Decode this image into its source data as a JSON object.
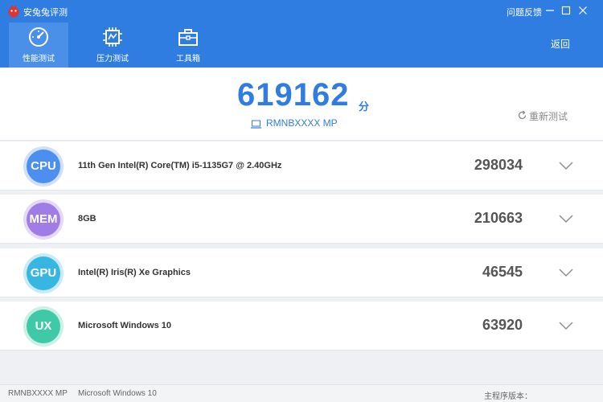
{
  "app": {
    "title": "安兔兔评测",
    "feedback": "问题反馈",
    "window_controls": [
      "minimize-icon",
      "maximize-icon",
      "close-icon"
    ]
  },
  "nav": {
    "tabs": [
      {
        "label": "性能测试",
        "icon": "speedometer-icon",
        "active": true
      },
      {
        "label": "压力测试",
        "icon": "chip-icon",
        "active": false
      },
      {
        "label": "工具箱",
        "icon": "toolbox-icon",
        "active": false
      }
    ],
    "back": "返回"
  },
  "score": {
    "total": "619162",
    "unit": "分",
    "device": "RMNBXXXX MP",
    "retest": "重新测试"
  },
  "rows": [
    {
      "badge": "CPU",
      "desc": "11th Gen Intel(R) Core(TM) i5-1135G7 @ 2.40GHz",
      "score": "298034",
      "color": "#4d8ff0",
      "ring": "#cfe0fb"
    },
    {
      "badge": "MEM",
      "desc": "8GB",
      "score": "210663",
      "color": "#a07de6",
      "ring": "#e4d9f7"
    },
    {
      "badge": "GPU",
      "desc": "Intel(R) Iris(R) Xe Graphics",
      "score": "46545",
      "color": "#36b6e0",
      "ring": "#c9ebf7"
    },
    {
      "badge": "UX",
      "desc": "Microsoft Windows 10",
      "score": "63920",
      "color": "#3fc9a6",
      "ring": "#cbf0e5"
    }
  ],
  "status": {
    "device": "RMNBXXXX MP",
    "os": "Microsoft Windows 10",
    "version_label": "主程序版本："
  },
  "colors": {
    "brand": "#2f7de1",
    "active_tab": "#4b90e8"
  }
}
